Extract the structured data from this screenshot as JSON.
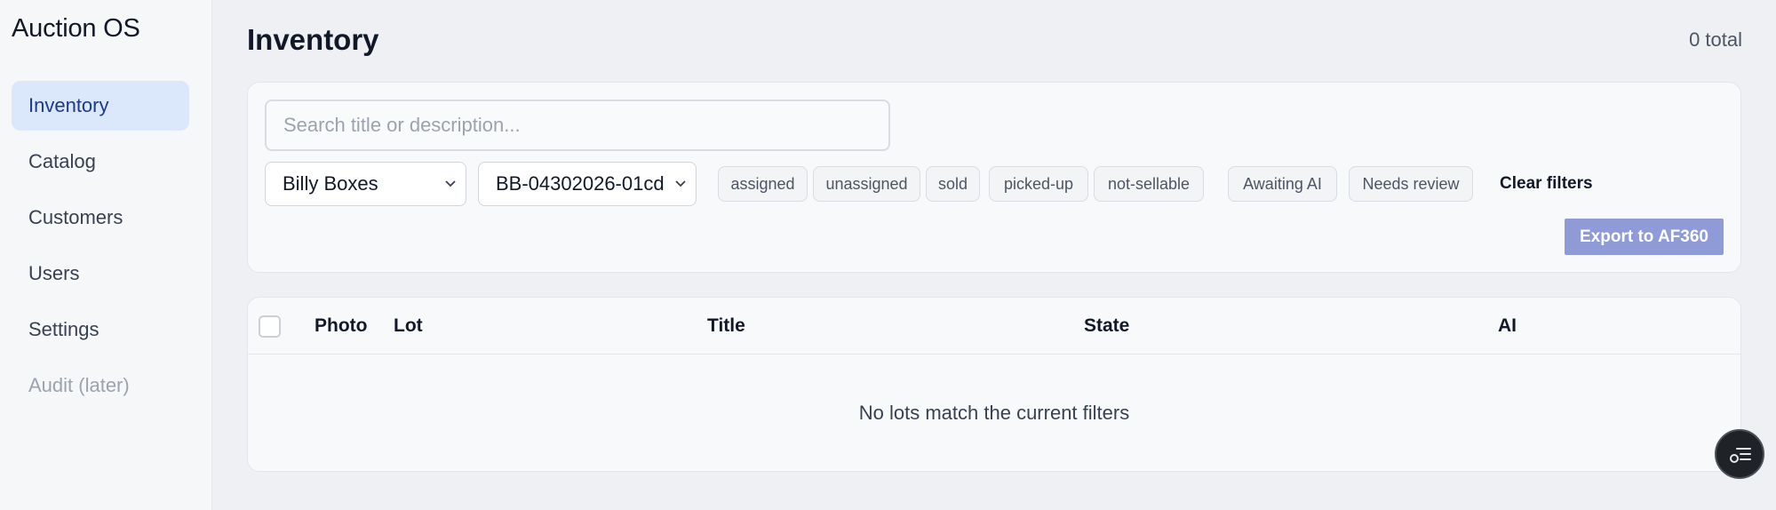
{
  "app": {
    "brand": "Auction OS"
  },
  "sidebar": {
    "items": [
      {
        "label": "Inventory",
        "active": true
      },
      {
        "label": "Catalog"
      },
      {
        "label": "Customers"
      },
      {
        "label": "Users"
      },
      {
        "label": "Settings"
      },
      {
        "label": "Audit (later)",
        "disabled": true
      }
    ]
  },
  "page": {
    "title": "Inventory",
    "total": "0 total"
  },
  "filters": {
    "search_placeholder": "Search title or description...",
    "client_select": "Billy Boxes",
    "batch_select": "BB-04302026-01cd",
    "state_chips": [
      "assigned",
      "unassigned",
      "sold",
      "picked-up",
      "not-sellable"
    ],
    "ai_chips": [
      "Awaiting AI",
      "Needs review"
    ],
    "clear_label": "Clear filters",
    "export_label": "Export to AF360"
  },
  "table": {
    "columns": [
      "Photo",
      "Lot",
      "Title",
      "State",
      "AI"
    ],
    "empty_message": "No lots match the current filters"
  },
  "icons": {
    "fab": "assistant-list-icon",
    "chevron": "chevron-down-icon"
  },
  "colors": {
    "accent": "#dbe7fb",
    "accent_text": "#1e3a8a",
    "export_button": "#8e9bd6"
  }
}
